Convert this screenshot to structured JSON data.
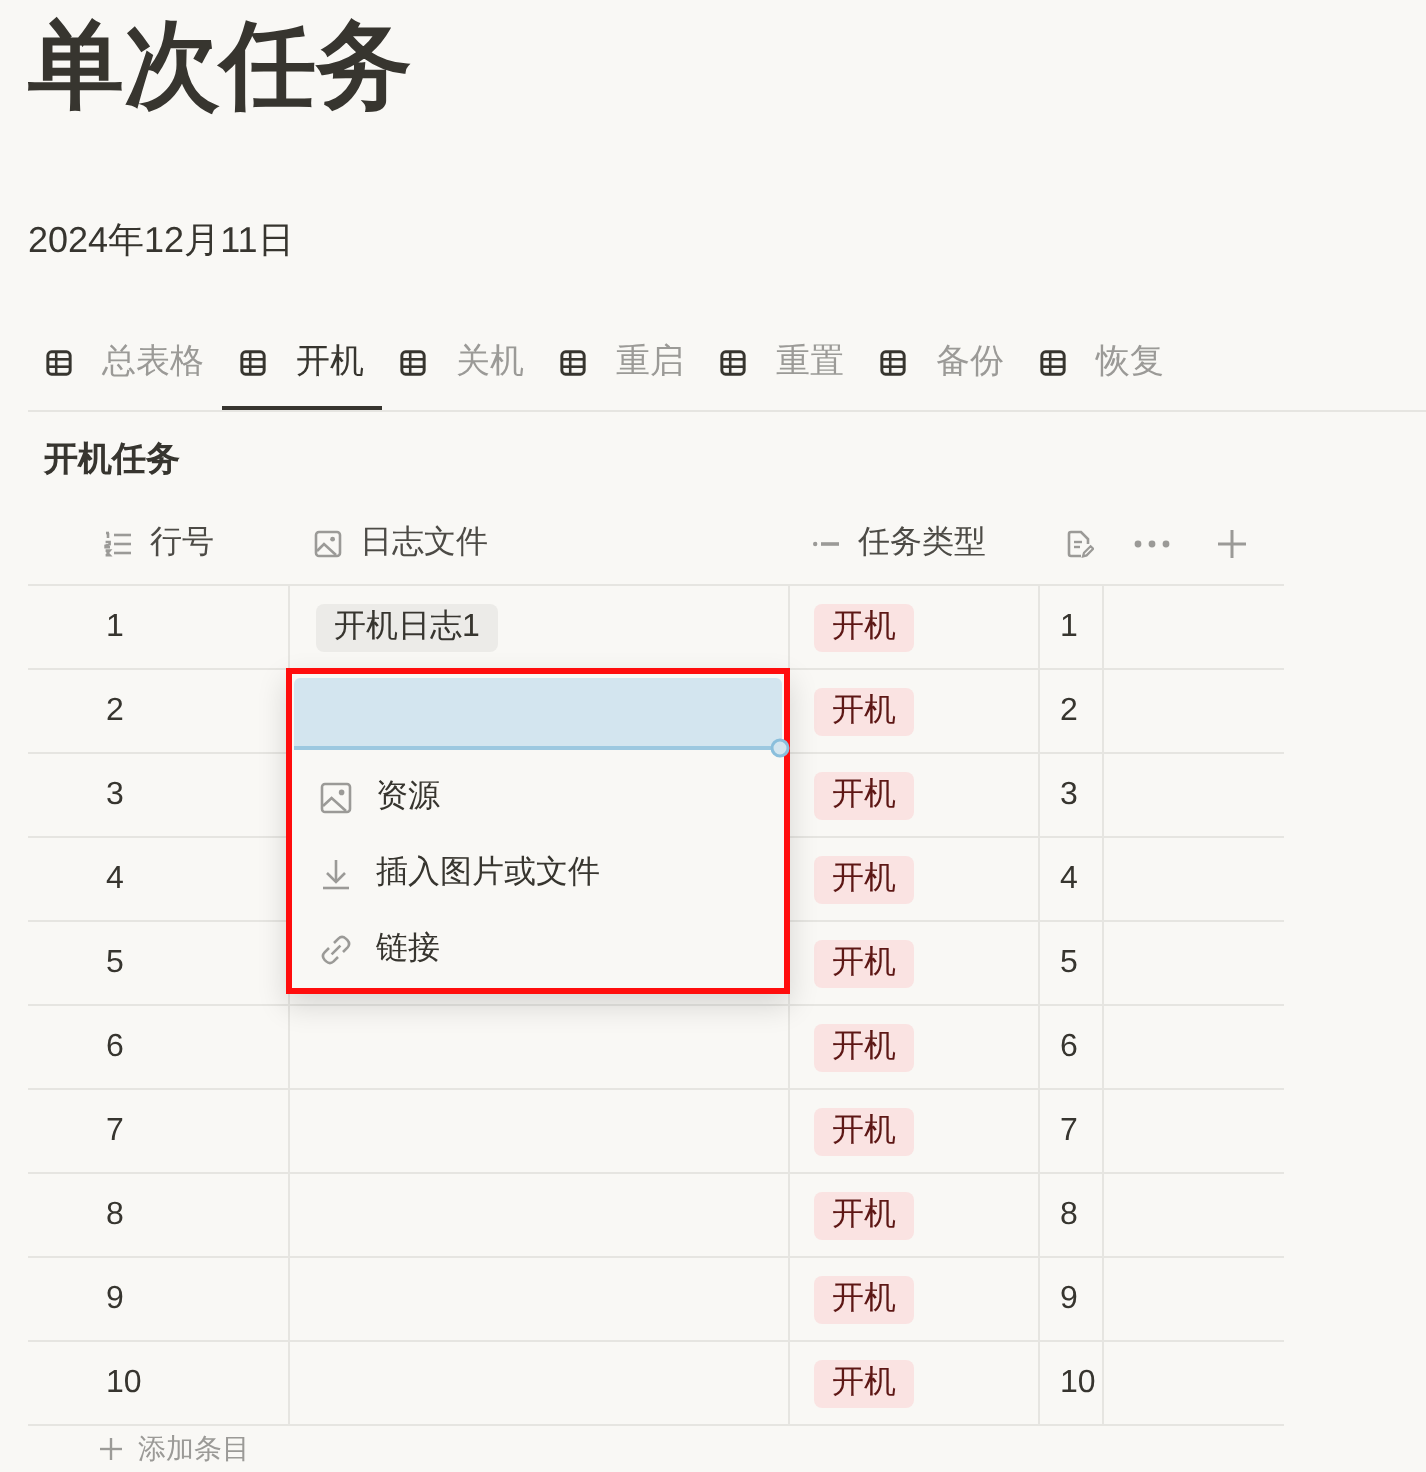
{
  "page": {
    "title": "单次任务",
    "date": "2024年12月11日"
  },
  "tabs": [
    {
      "label": "总表格",
      "selected": false
    },
    {
      "label": "开机",
      "selected": true
    },
    {
      "label": "关机",
      "selected": false
    },
    {
      "label": "重启",
      "selected": false
    },
    {
      "label": "重置",
      "selected": false
    },
    {
      "label": "备份",
      "selected": false
    },
    {
      "label": "恢复",
      "selected": false
    }
  ],
  "table": {
    "title": "开机任务",
    "columns": [
      "行号",
      "日志文件",
      "任务类型"
    ],
    "rows": [
      {
        "row_number": "1",
        "log_files": [
          "开机日志1"
        ],
        "task_type": "开机",
        "column_4": "1"
      },
      {
        "row_number": "2",
        "task_type": "开机",
        "column_4": "2",
        "file_menu": {
          "items": [
            {
              "label": "资源",
              "kind": "library"
            },
            {
              "label": "插入图片或文件",
              "kind": "upload"
            },
            {
              "label": "链接",
              "kind": "link"
            }
          ]
        }
      },
      {
        "row_number": "3",
        "task_type": "开机",
        "column_4": "3"
      },
      {
        "row_number": "4",
        "task_type": "开机",
        "column_4": "4"
      },
      {
        "row_number": "5",
        "task_type": "开机",
        "column_4": "5"
      },
      {
        "row_number": "6",
        "task_type": "开机",
        "column_4": "6"
      },
      {
        "row_number": "7",
        "task_type": "开机",
        "column_4": "7"
      },
      {
        "row_number": "8",
        "task_type": "开机",
        "column_4": "8"
      },
      {
        "row_number": "9",
        "task_type": "开机",
        "column_4": "9"
      },
      {
        "row_number": "10",
        "task_type": "开机",
        "column_4": "10"
      }
    ],
    "add_row": "添加条目"
  }
}
